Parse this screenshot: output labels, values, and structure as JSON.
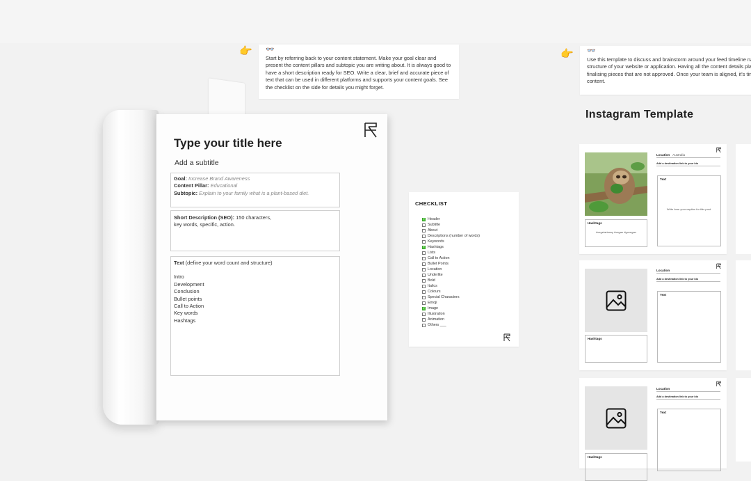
{
  "notes": {
    "left": {
      "icon": "glasses-icon",
      "text": "Start by referring back to your content statement. Make your goal clear and present the content pillars and subtopic you are writing about. It is always good to have a short description ready for SEO. Write a clear, brief and accurate piece of text that can be used in different platforms and supports your content goals. See the checklist on the side for details you might forget."
    },
    "right": {
      "icon": "glasses-icon",
      "text": "Use this template to discuss and brainstorm around your feed timeline na structure of your website or application. Having all the content details pla finalising pieces that are not approved. Once your team is aligned, it's tim content."
    }
  },
  "document": {
    "title": "Type your title here",
    "subtitle": "Add a subtitle",
    "goal_label": "Goal:",
    "goal_value": "Increase Brand Awareness",
    "pillar_label": "Content Pillar:",
    "pillar_value": "Educational",
    "subtopic_label": "Subtopic:",
    "subtopic_value": "Explain to your family what is a plant-based diet.",
    "short_desc_label": "Short Description (SEO):",
    "short_desc_value": "150 characters,",
    "short_desc_value2": "key words, specific, action.",
    "text_label": "Text",
    "text_hint": "(define your word count and structure)",
    "structure": [
      "Intro",
      "Development",
      "Conclusion",
      "Bullet points",
      "Call to Action",
      "Key words",
      "Hashtags"
    ]
  },
  "checklist": {
    "title": "CHECKLIST",
    "items": [
      {
        "label": "Header",
        "checked": true
      },
      {
        "label": "Subtitle",
        "checked": false
      },
      {
        "label": "About",
        "checked": false
      },
      {
        "label": "Descriptions (number of words)",
        "checked": false
      },
      {
        "label": "Keywords",
        "checked": false
      },
      {
        "label": "Hashtags",
        "checked": true
      },
      {
        "label": "Lists",
        "checked": false
      },
      {
        "label": "Call to Action",
        "checked": false
      },
      {
        "label": "Bullet Points",
        "checked": false
      },
      {
        "label": "Location",
        "checked": false
      },
      {
        "label": "Underlite",
        "checked": false
      },
      {
        "label": "Bold",
        "checked": false
      },
      {
        "label": "Italics",
        "checked": false
      },
      {
        "label": "Colours",
        "checked": false
      },
      {
        "label": "Special Characters",
        "checked": false
      },
      {
        "label": "Emoji",
        "checked": false
      },
      {
        "label": "Image",
        "checked": true
      },
      {
        "label": "Illustration",
        "checked": false
      },
      {
        "label": "Animation",
        "checked": false
      },
      {
        "label": "Others ___",
        "checked": false
      }
    ]
  },
  "instagram": {
    "title": "Instagram Template",
    "cards": [
      {
        "location_label": "Location",
        "location_value": "Australia",
        "dest": "Add a destination link to your bio",
        "hashtags_label": "Hashtags",
        "hashtags_value": "#vegetariansy #vegan #govegan",
        "text_label": "Text",
        "text_value": "Write here your caption for this post.",
        "has_photo": true
      },
      {
        "location_label": "Location",
        "location_value": "",
        "dest": "Add a destination link to your bio",
        "hashtags_label": "Hashtags",
        "hashtags_value": "",
        "text_label": "Text",
        "text_value": "",
        "has_photo": false
      },
      {
        "location_label": "Location",
        "location_value": "",
        "dest": "Add a destination link to your bio",
        "hashtags_label": "Hashtags",
        "hashtags_value": "",
        "text_label": "Text",
        "text_value": "",
        "has_photo": false
      }
    ]
  },
  "colors": {
    "check": "#4cc43a",
    "bg": "#f2f2f2"
  }
}
